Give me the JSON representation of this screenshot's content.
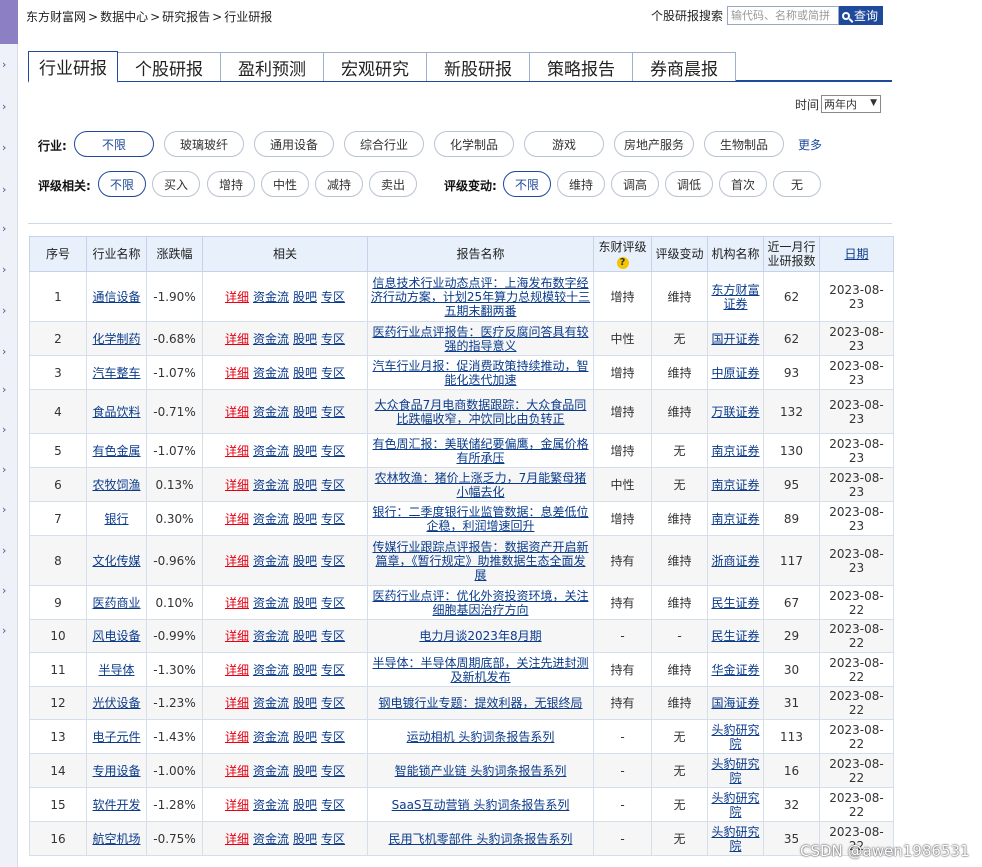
{
  "breadcrumb": [
    "东方财富网",
    ">",
    "数据中心",
    ">",
    "研究报告",
    ">",
    "行业研报"
  ],
  "search": {
    "label": "个股研报搜索",
    "placeholder": "输代码、名称或简拼",
    "button_label": "查询"
  },
  "main_tabs": [
    "行业研报",
    "个股研报",
    "盈利预测",
    "宏观研究",
    "新股研报",
    "策略报告",
    "券商晨报"
  ],
  "active_tab": 0,
  "time_filter": {
    "label": "时间",
    "value": "两年内"
  },
  "industry_filter": {
    "label": "行业:",
    "options": [
      "不限",
      "玻璃玻纤",
      "通用设备",
      "综合行业",
      "化学制品",
      "游戏",
      "房地产服务",
      "生物制品"
    ],
    "more": "更多"
  },
  "rating_filter": {
    "label": "评级相关:",
    "options": [
      "不限",
      "买入",
      "增持",
      "中性",
      "减持",
      "卖出"
    ]
  },
  "rating_change_filter": {
    "label": "评级变动:",
    "options": [
      "不限",
      "维持",
      "调高",
      "调低",
      "首次",
      "无"
    ]
  },
  "table": {
    "headers": [
      "序号",
      "行业名称",
      "涨跌幅",
      "相关",
      "报告名称",
      "东财评级",
      "评级变动",
      "机构名称",
      "近一月行业研报数",
      "日期"
    ],
    "link_labels": [
      "详细",
      "资金流",
      "股吧",
      "专区"
    ],
    "rows": [
      {
        "no": "1",
        "industry": "通信设备",
        "change": "-1.90%",
        "dir": "down",
        "title": "信息技术行业动态点评：上海发布数字经济行动方案，计划25年算力总规模较十三五期末翻两番",
        "rating": "增持",
        "rating_change": "维持",
        "org": "东方财富证券",
        "count": "62",
        "date": "2023-08-23"
      },
      {
        "no": "2",
        "industry": "化学制药",
        "change": "-0.68%",
        "dir": "down",
        "title": "医药行业点评报告：医疗反腐问答具有较强的指导意义",
        "rating": "中性",
        "rating_change": "无",
        "org": "国开证券",
        "count": "62",
        "date": "2023-08-23"
      },
      {
        "no": "3",
        "industry": "汽车整车",
        "change": "-1.07%",
        "dir": "down",
        "title": "汽车行业月报：促消费政策持续推动，智能化迭代加速",
        "rating": "增持",
        "rating_change": "维持",
        "org": "中原证券",
        "count": "93",
        "date": "2023-08-23"
      },
      {
        "no": "4",
        "industry": "食品饮料",
        "change": "-0.71%",
        "dir": "down",
        "title": "大众食品7月电商数据跟踪：大众食品同比跌幅收窄，冲饮同比由负转正",
        "rating": "增持",
        "rating_change": "维持",
        "org": "万联证券",
        "count": "132",
        "date": "2023-08-23"
      },
      {
        "no": "5",
        "industry": "有色金属",
        "change": "-1.07%",
        "dir": "down",
        "title": "有色周汇报：美联储纪要偏鹰，金属价格有所承压",
        "rating": "增持",
        "rating_change": "无",
        "org": "南京证券",
        "count": "130",
        "date": "2023-08-23"
      },
      {
        "no": "6",
        "industry": "农牧饲渔",
        "change": "0.13%",
        "dir": "up",
        "title": "农林牧渔：猪价上涨乏力，7月能繁母猪小幅去化",
        "rating": "中性",
        "rating_change": "无",
        "org": "南京证券",
        "count": "95",
        "date": "2023-08-23"
      },
      {
        "no": "7",
        "industry": "银行",
        "change": "0.30%",
        "dir": "up",
        "title": "银行：二季度银行业监管数据：息差低位企稳，利润增速回升",
        "rating": "增持",
        "rating_change": "维持",
        "org": "南京证券",
        "count": "89",
        "date": "2023-08-23"
      },
      {
        "no": "8",
        "industry": "文化传媒",
        "change": "-0.96%",
        "dir": "down",
        "title": "传媒行业跟踪点评报告：数据资产开启新篇章，《暂行规定》助推数据生态全面发展",
        "rating": "持有",
        "rating_change": "维持",
        "org": "浙商证券",
        "count": "117",
        "date": "2023-08-23"
      },
      {
        "no": "9",
        "industry": "医药商业",
        "change": "0.10%",
        "dir": "up",
        "title": "医药行业点评：优化外资投资环境，关注细胞基因治疗方向",
        "rating": "持有",
        "rating_change": "维持",
        "org": "民生证券",
        "count": "67",
        "date": "2023-08-22"
      },
      {
        "no": "10",
        "industry": "风电设备",
        "change": "-0.99%",
        "dir": "down",
        "title": "电力月谈2023年8月期",
        "rating": "-",
        "rating_change": "-",
        "org": "民生证券",
        "count": "29",
        "date": "2023-08-22"
      },
      {
        "no": "11",
        "industry": "半导体",
        "change": "-1.30%",
        "dir": "down",
        "title": "半导体：半导体周期底部，关注先进封测及新机发布",
        "rating": "持有",
        "rating_change": "维持",
        "org": "华金证券",
        "count": "30",
        "date": "2023-08-22"
      },
      {
        "no": "12",
        "industry": "光伏设备",
        "change": "-1.23%",
        "dir": "down",
        "title": "钢电镀行业专题：提效利器，无银终局",
        "rating": "持有",
        "rating_change": "维持",
        "org": "国海证券",
        "count": "31",
        "date": "2023-08-22"
      },
      {
        "no": "13",
        "industry": "电子元件",
        "change": "-1.43%",
        "dir": "down",
        "title": "运动相机 头豹词条报告系列",
        "rating": "-",
        "rating_change": "无",
        "org": "头豹研究院",
        "count": "113",
        "date": "2023-08-22"
      },
      {
        "no": "14",
        "industry": "专用设备",
        "change": "-1.00%",
        "dir": "down",
        "title": "智能锁产业链 头豹词条报告系列",
        "rating": "-",
        "rating_change": "无",
        "org": "头豹研究院",
        "count": "16",
        "date": "2023-08-22"
      },
      {
        "no": "15",
        "industry": "软件开发",
        "change": "-1.28%",
        "dir": "down",
        "title": "SaaS互动营销 头豹词条报告系列",
        "rating": "-",
        "rating_change": "无",
        "org": "头豹研究院",
        "count": "32",
        "date": "2023-08-22"
      },
      {
        "no": "16",
        "industry": "航空机场",
        "change": "-0.75%",
        "dir": "down",
        "title": "民用飞机零部件 头豹词条报告系列",
        "rating": "-",
        "rating_change": "无",
        "org": "头豹研究院",
        "count": "35",
        "date": "2023-08-22"
      }
    ]
  },
  "watermark": "CSDN @awen1986531",
  "colors": {
    "accent": "#1f4a9b",
    "up": "#e60012",
    "down": "#009900",
    "header_bg": "#e8f1fb"
  }
}
